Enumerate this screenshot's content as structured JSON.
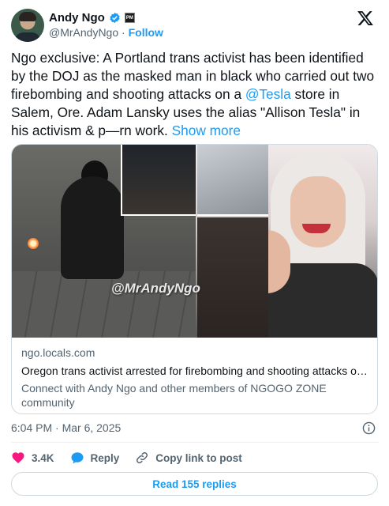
{
  "author": {
    "display_name": "Andy Ngo",
    "handle": "@MrAndyNgo",
    "follow_label": "Follow",
    "affiliation_badge": "PM",
    "verified_color": "#1d9bf0"
  },
  "tweet": {
    "text_part1": "Ngo exclusive: A Portland trans activist has been identified by the DOJ as the masked man in black who carried out two firebombing and shooting attacks on a ",
    "mention": "@Tesla",
    "text_part2": " store in Salem, Ore. Adam Lansky uses the alias \"Allison Tesla\" in his activism & p—rn work. ",
    "show_more": "Show more"
  },
  "card": {
    "watermark": "@MrAndyNgo",
    "domain": "ngo.locals.com",
    "title": "Oregon trans activist arrested for firebombing and shooting attacks on T…",
    "description": "Connect with Andy Ngo and other members of NGOGO ZONE community"
  },
  "meta": {
    "timestamp": "6:04 PM · Mar 6, 2025"
  },
  "actions": {
    "likes": "3.4K",
    "reply": "Reply",
    "copy_link": "Copy link to post"
  },
  "replies_button": "Read 155 replies",
  "colors": {
    "accent": "#1d9bf0",
    "heart": "#f91880",
    "text": "#0f1419",
    "muted": "#536471"
  },
  "icons": [
    "verified-badge-icon",
    "x-logo-icon",
    "info-icon",
    "heart-icon",
    "reply-bubble-icon",
    "link-icon"
  ]
}
